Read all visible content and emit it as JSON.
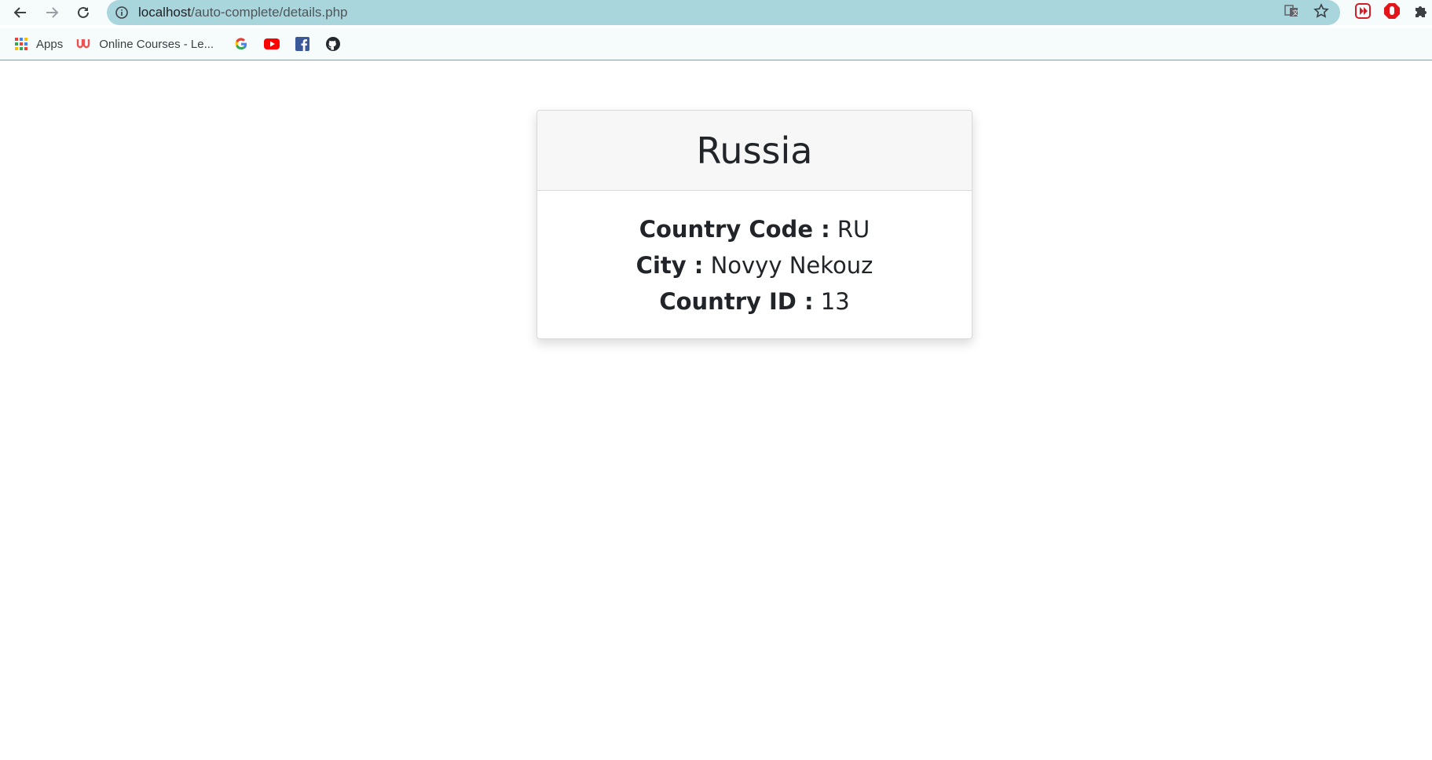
{
  "browser": {
    "url_host": "localhost",
    "url_path": "/auto-complete/details.php"
  },
  "bookmarks": [
    {
      "label": "Apps",
      "icon": "apps-grid-icon"
    },
    {
      "label": "Online Courses - Le...",
      "icon": "udemy-icon"
    },
    {
      "label": "",
      "icon": "google-icon"
    },
    {
      "label": "",
      "icon": "youtube-icon"
    },
    {
      "label": "",
      "icon": "facebook-icon"
    },
    {
      "label": "",
      "icon": "github-icon"
    }
  ],
  "card": {
    "title": "Russia",
    "fields": [
      {
        "label": "Country Code :",
        "value": "RU"
      },
      {
        "label": "City :",
        "value": "Novyy Nekouz"
      },
      {
        "label": "Country ID :",
        "value": "13"
      }
    ]
  },
  "colors": {
    "omnibox": "#a9d5dc",
    "toolbar": "#f6fbfc",
    "card_header": "#f7f7f7",
    "text": "#212529"
  }
}
